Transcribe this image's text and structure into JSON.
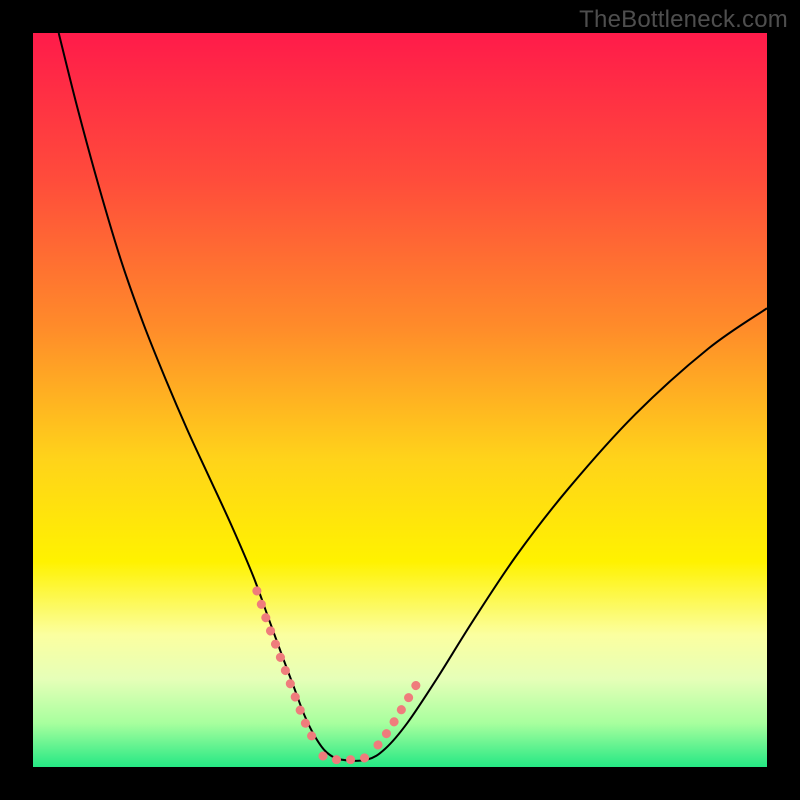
{
  "watermark": "TheBottleneck.com",
  "chart_data": {
    "type": "line",
    "title": "",
    "xlabel": "",
    "ylabel": "",
    "xlim": [
      0,
      100
    ],
    "ylim": [
      0,
      100
    ],
    "grid": false,
    "legend": false,
    "background": {
      "type": "vertical-gradient",
      "stops": [
        {
          "pos": 0.0,
          "color": "#ff1b4a"
        },
        {
          "pos": 0.2,
          "color": "#ff4c3b"
        },
        {
          "pos": 0.4,
          "color": "#ff8b2a"
        },
        {
          "pos": 0.58,
          "color": "#ffd31a"
        },
        {
          "pos": 0.72,
          "color": "#fff200"
        },
        {
          "pos": 0.82,
          "color": "#fbffa0"
        },
        {
          "pos": 0.88,
          "color": "#e6ffb8"
        },
        {
          "pos": 0.94,
          "color": "#a8ff9e"
        },
        {
          "pos": 1.0,
          "color": "#25e884"
        }
      ]
    },
    "series": [
      {
        "name": "bottleneck-curve",
        "stroke": "#000000",
        "stroke_width": 2,
        "x": [
          3.5,
          6,
          9,
          12,
          15,
          18,
          21,
          24,
          27,
          30,
          32,
          34,
          35.5,
          37,
          38.5,
          40,
          42,
          45.5,
          48,
          51,
          55,
          60,
          66,
          73,
          82,
          92,
          100
        ],
        "y": [
          100,
          90,
          79,
          69,
          60.5,
          53,
          46,
          39.5,
          33,
          26,
          20.5,
          15,
          11,
          7,
          4,
          2,
          1,
          1,
          2.5,
          6,
          12,
          20,
          29,
          38,
          48,
          57,
          62.5
        ]
      },
      {
        "name": "highlight-left",
        "stroke": "#ef7c7c",
        "stroke_width": 9,
        "linecap": "round",
        "dash": [
          0.1,
          14
        ],
        "x": [
          30.5,
          32,
          33.5,
          35,
          36.3,
          37.5,
          38.7
        ],
        "y": [
          24,
          19.5,
          15.5,
          11.5,
          8,
          5,
          3
        ]
      },
      {
        "name": "highlight-bottom",
        "stroke": "#ef7c7c",
        "stroke_width": 9,
        "linecap": "round",
        "dash": [
          0.1,
          14
        ],
        "x": [
          39.5,
          41,
          42.5,
          44,
          45.5
        ],
        "y": [
          1.5,
          1,
          1,
          1,
          1.3
        ]
      },
      {
        "name": "highlight-right",
        "stroke": "#ef7c7c",
        "stroke_width": 9,
        "linecap": "round",
        "dash": [
          0.1,
          14
        ],
        "x": [
          47,
          48.5,
          50,
          51.5,
          53
        ],
        "y": [
          3,
          5,
          7.5,
          10,
          12.5
        ]
      }
    ]
  }
}
